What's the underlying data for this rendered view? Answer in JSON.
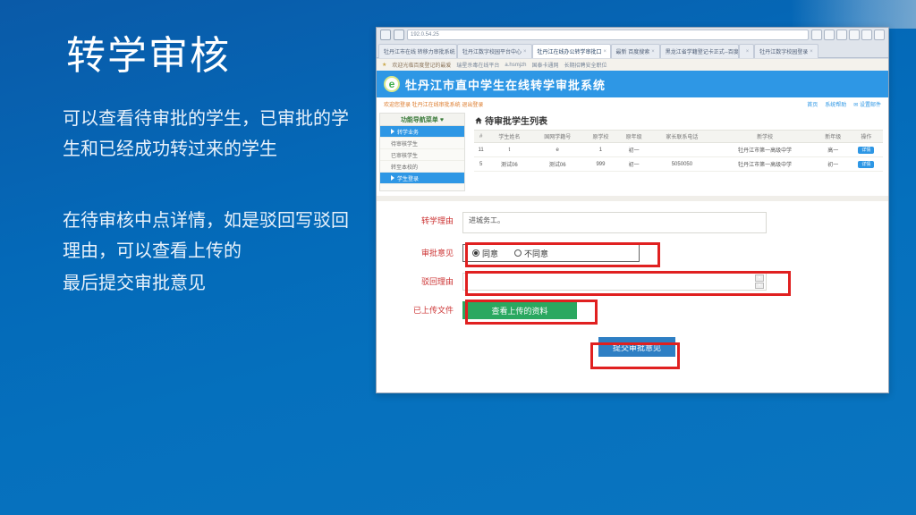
{
  "slide": {
    "title": "转学审核",
    "para1": "可以查看待审批的学生，已审批的学生和已经成功转过来的学生",
    "para2": "在待审核中点详情，如是驳回写驳回理由，可以查看上传的",
    "para3": "最后提交审批意见"
  },
  "browser": {
    "address": "192.0.54.25",
    "tabs": [
      {
        "label": "牡丹江市在线 转移力审批系统"
      },
      {
        "label": "牡丹江数字校园平台中心"
      },
      {
        "label": "牡丹江在线办公转学审批口"
      },
      {
        "label": "最新 百度搜索"
      },
      {
        "label": "黑龙江省学籍登记卡正式--百度文"
      },
      {
        "label": ""
      },
      {
        "label": "牡丹江数字校园登录"
      }
    ],
    "fav_left": "欢迎光临百度登记的最爱",
    "fav_items": [
      "瑞星杀毒在线平台",
      "a.hsmjzh",
      "国泰卡通网",
      "长期招聘安全职位"
    ]
  },
  "app": {
    "logo_letter": "e",
    "title": "牡丹江市直中学生在线转学审批系统",
    "welcome": "欢迎您登录 牡丹江在线审批系统   退出登录",
    "links": [
      "首页",
      "系统帮助",
      "✉ 设置邮件"
    ]
  },
  "sidebar": {
    "header": "功能导航菜单 ♥",
    "items": [
      {
        "label": "转学业务",
        "on": true
      },
      {
        "label": "待审核学生"
      },
      {
        "label": "已审核学生"
      },
      {
        "label": "转至本校的"
      },
      {
        "label": "学生登录",
        "on": true
      }
    ]
  },
  "table": {
    "title": "待审批学生列表",
    "headers": [
      "#",
      "学生姓名",
      "国网学籍号",
      "原学校",
      "原年级",
      "家长联系电话",
      "新学校",
      "新年级",
      "操作"
    ],
    "rows": [
      {
        "c": [
          "11",
          "t",
          "e",
          "1",
          "初一",
          "",
          "牡丹江市第一高级中学",
          "高一"
        ],
        "op": "详情"
      },
      {
        "c": [
          "5",
          "测试06",
          "测试06",
          "999",
          "初一",
          "5050050",
          "牡丹江市第一高级中学",
          "初一"
        ],
        "op": "详情"
      }
    ]
  },
  "form": {
    "labels": {
      "reason": "转学理由",
      "opinion": "审批意见",
      "reject": "驳回理由",
      "files": "已上传文件"
    },
    "reason_value": "进城务工。",
    "agree": "同意",
    "disagree": "不同意",
    "view_btn": "查看上传的资料",
    "submit_btn": "提交审批意见"
  }
}
